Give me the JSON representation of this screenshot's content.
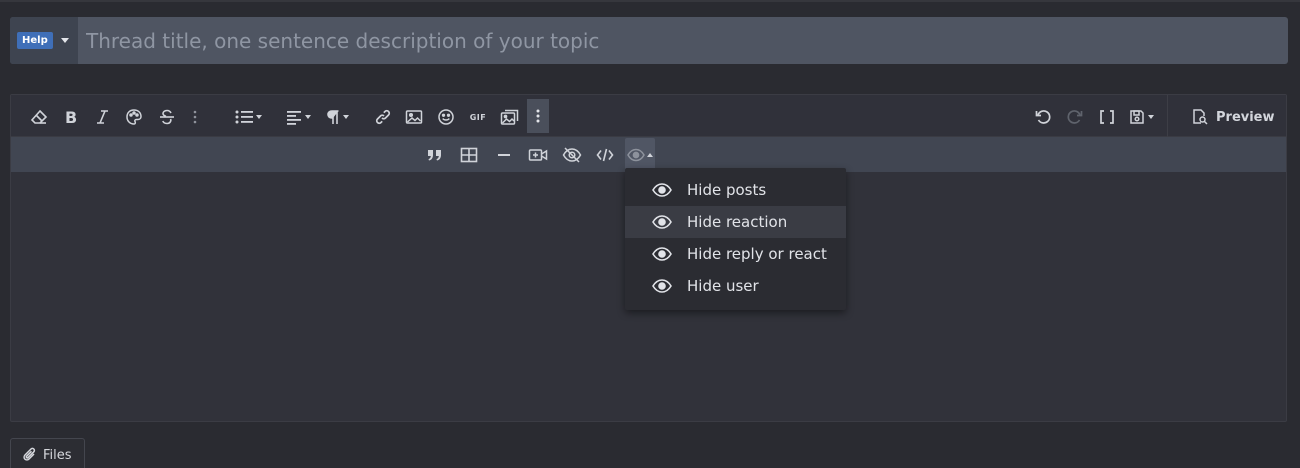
{
  "title_row": {
    "prefix_badge": "Help",
    "title_placeholder": "Thread title, one sentence description of your topic"
  },
  "toolbar": {
    "preview_label": "Preview",
    "gif_label": "GIF"
  },
  "hide_menu": {
    "items": [
      {
        "label": "Hide posts"
      },
      {
        "label": "Hide reaction"
      },
      {
        "label": "Hide reply or react"
      },
      {
        "label": "Hide user"
      }
    ],
    "highlighted_index": 1
  },
  "attachments": {
    "files_label": "Files"
  },
  "colors": {
    "background": "#2a2b31",
    "title_bar": "#4f5562",
    "badge": "#3f6fb8",
    "toolbar_secondary": "#414652",
    "menu_bg": "#2b2c32"
  }
}
